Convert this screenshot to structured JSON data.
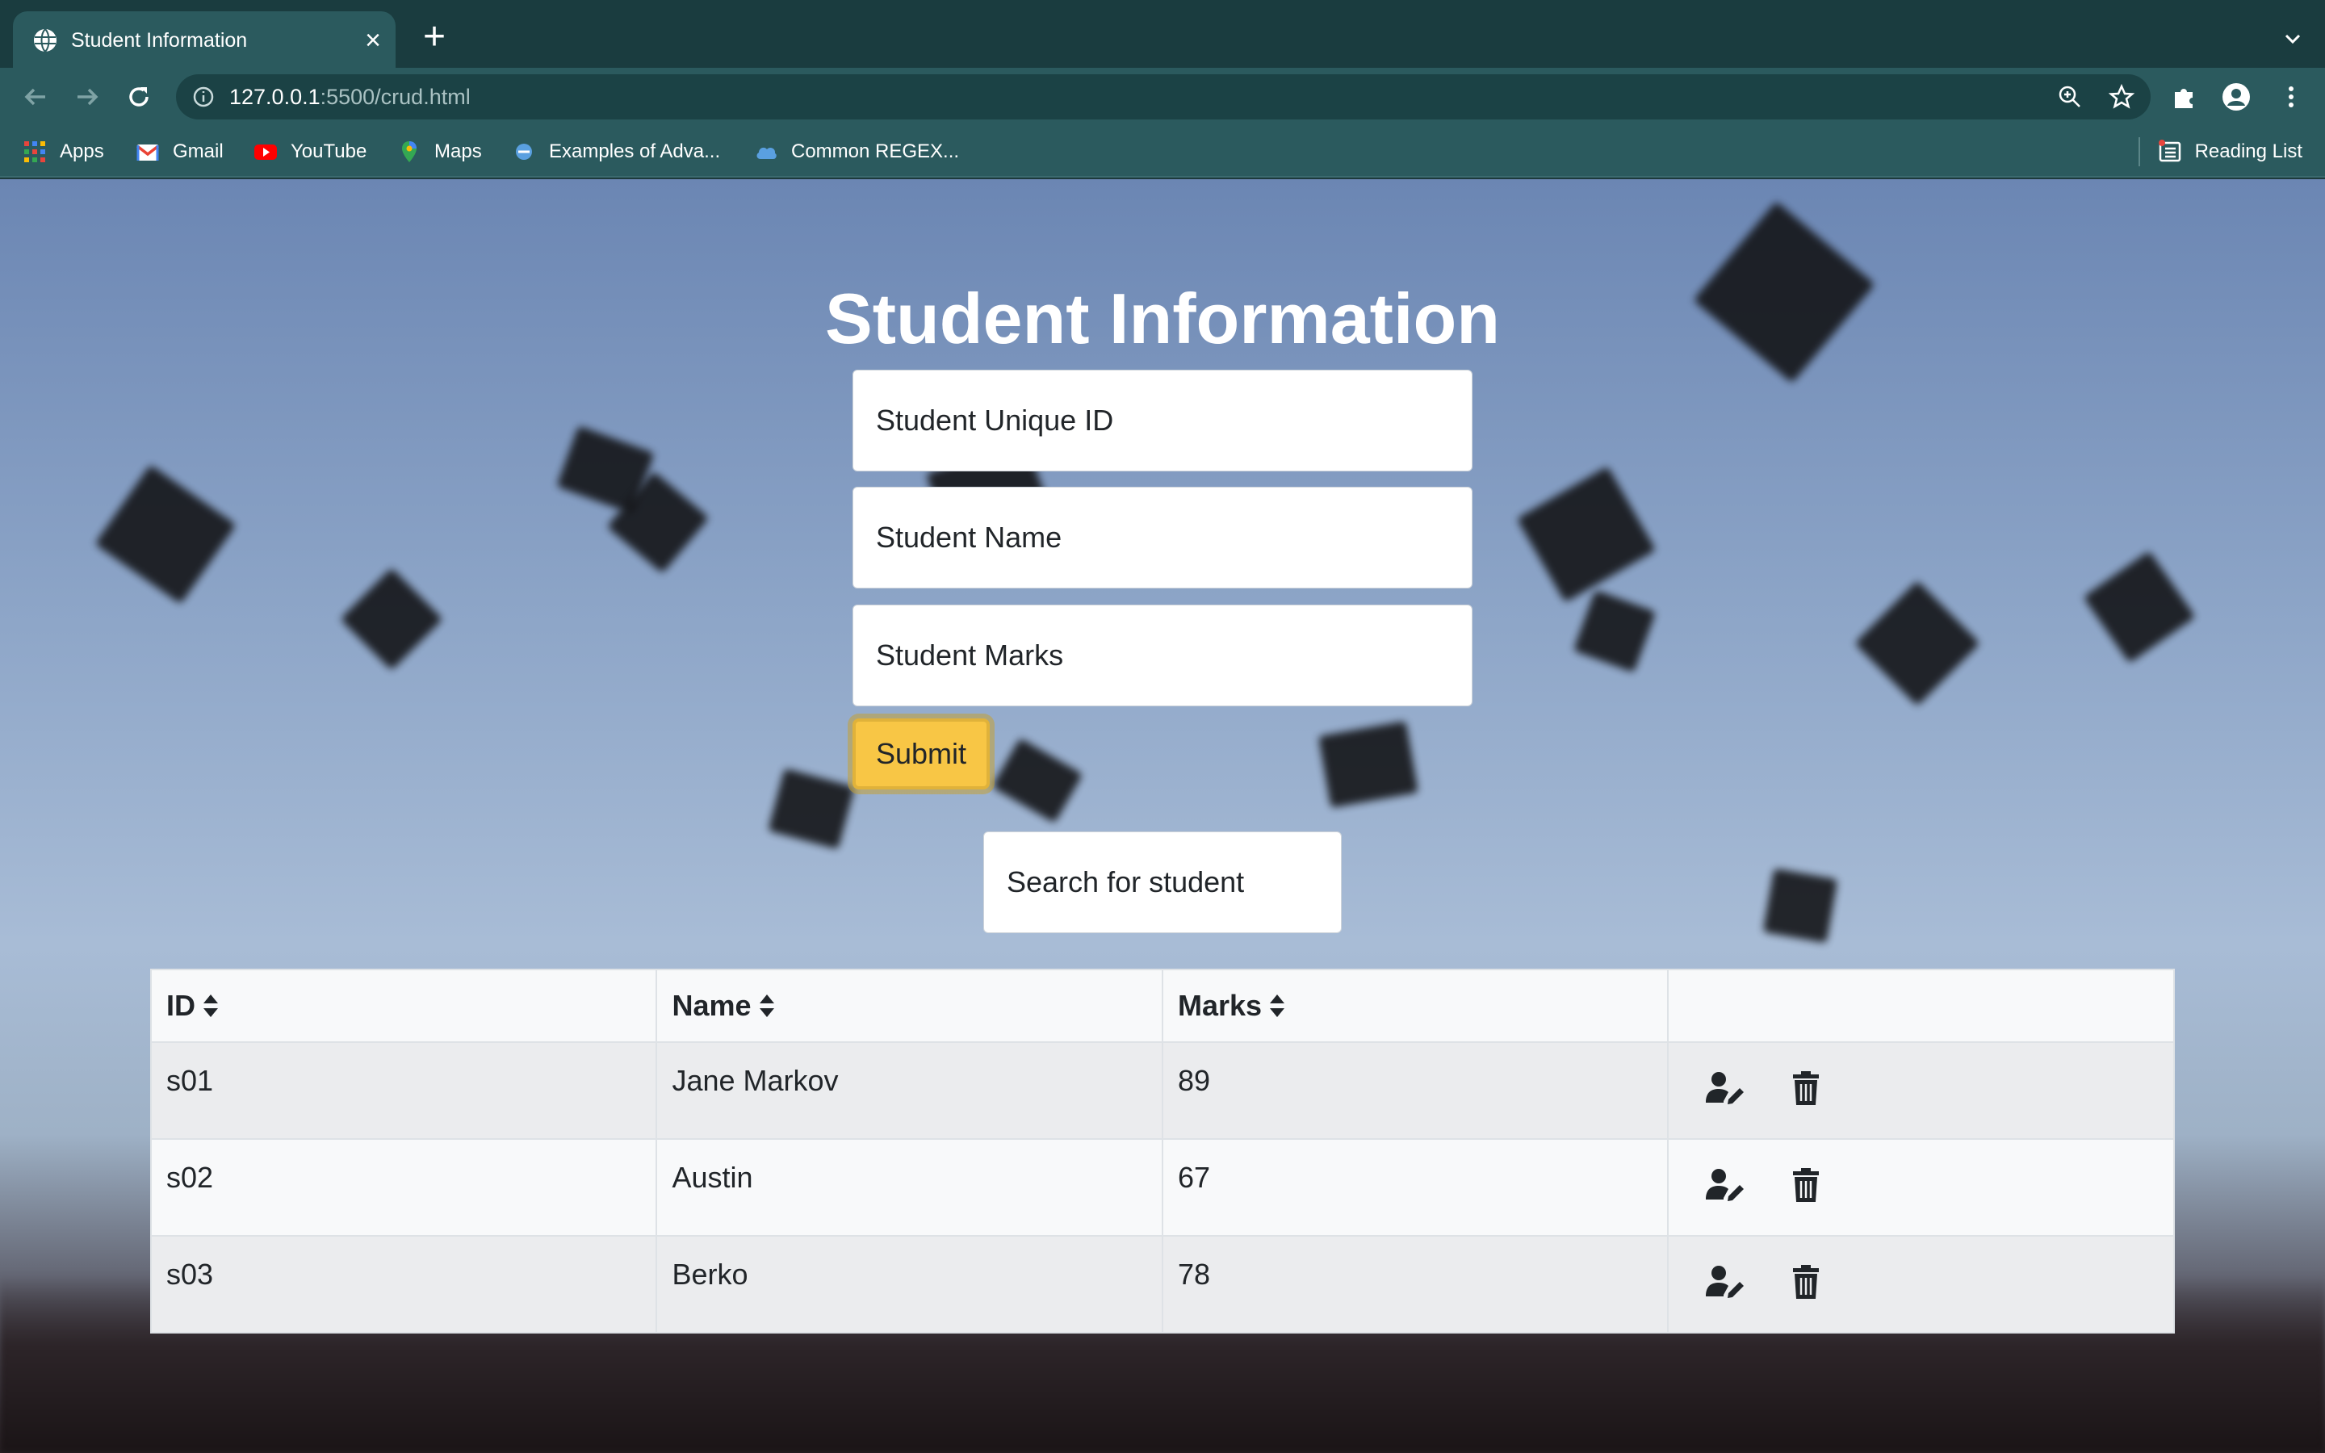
{
  "browser": {
    "tab_title": "Student Information",
    "url_host": "127.0.0.1",
    "url_rest": ":5500/crud.html",
    "bookmarks": [
      {
        "label": "Apps",
        "icon": "apps-grid-icon"
      },
      {
        "label": "Gmail",
        "icon": "gmail-icon"
      },
      {
        "label": "YouTube",
        "icon": "youtube-icon"
      },
      {
        "label": "Maps",
        "icon": "maps-icon"
      },
      {
        "label": "Examples of Adva...",
        "icon": "bookmark-favicon-icon"
      },
      {
        "label": "Common REGEX...",
        "icon": "cloud-icon"
      }
    ],
    "reading_list": "Reading List"
  },
  "page": {
    "title": "Student Information",
    "form": {
      "id_placeholder": "Student Unique ID",
      "name_placeholder": "Student Name",
      "marks_placeholder": "Student Marks",
      "submit_label": "Submit"
    },
    "search_placeholder": "Search for student",
    "table": {
      "headers": [
        "ID",
        "Name",
        "Marks",
        ""
      ],
      "rows": [
        {
          "id": "s01",
          "name": "Jane Markov",
          "marks": "89"
        },
        {
          "id": "s02",
          "name": "Austin",
          "marks": "67"
        },
        {
          "id": "s03",
          "name": "Berko",
          "marks": "78"
        }
      ]
    }
  },
  "colors": {
    "submit": "#f8c645",
    "chrome_dark": "#1a3c3f",
    "chrome": "#2b5a5e"
  }
}
